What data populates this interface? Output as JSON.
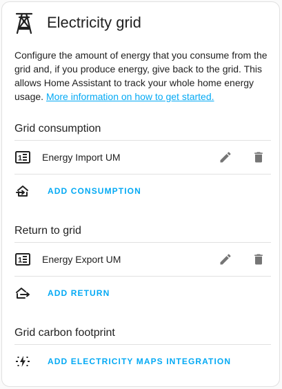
{
  "header": {
    "title": "Electricity grid",
    "icon": "transmission-tower-icon"
  },
  "description": {
    "text": "Configure the amount of energy that you consume from the grid and, if you produce energy, give back to the grid. This allows Home Assistant to track your whole home energy usage. ",
    "link_text": "More information on how to get started."
  },
  "consumption": {
    "title": "Grid consumption",
    "items": [
      {
        "label": "Energy Import UM",
        "icon": "meter-icon"
      }
    ],
    "add_label": "ADD CONSUMPTION"
  },
  "return": {
    "title": "Return to grid",
    "items": [
      {
        "label": "Energy Export UM",
        "icon": "meter-icon"
      }
    ],
    "add_label": "ADD RETURN"
  },
  "carbon": {
    "title": "Grid carbon footprint",
    "add_label": "ADD ELECTRICITY MAPS INTEGRATION"
  },
  "colors": {
    "accent": "#03a9f4",
    "icon": "#212121",
    "action_icon": "#757575",
    "divider": "#e0e0e0"
  }
}
